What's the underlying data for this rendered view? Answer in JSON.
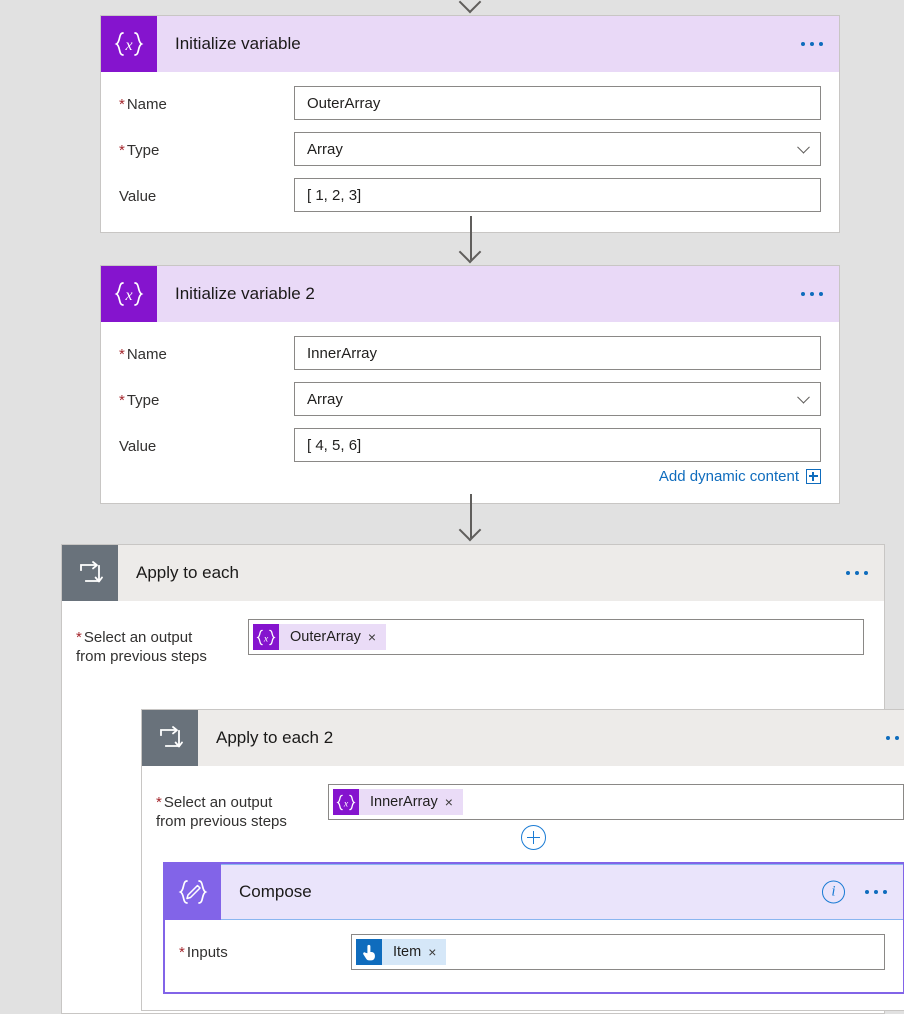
{
  "page": {
    "background_color": "#e1e1e1",
    "app": "Power Automate flow designer"
  },
  "colors": {
    "variable_icon": "#8514ce",
    "variable_header": "#e9d9f7",
    "loop_icon": "#69727b",
    "loop_header": "#edebe9",
    "compose_icon": "#8264e8",
    "compose_header": "#eae4fb",
    "selection_border": "#8264e8",
    "link_blue": "#0f6cbd",
    "required_red": "#a4262c",
    "item_token": "#0f6cbd"
  },
  "cards": {
    "initialize_variable_1": {
      "title": "Initialize variable",
      "icon": "variable-braces-x-icon",
      "menu": "more-commands",
      "fields": [
        {
          "label": "Name",
          "required": true,
          "value": "OuterArray",
          "control": "text"
        },
        {
          "label": "Type",
          "required": true,
          "value": "Array",
          "control": "dropdown"
        },
        {
          "label": "Value",
          "required": false,
          "value": "[ 1, 2, 3]",
          "control": "text"
        }
      ]
    },
    "initialize_variable_2": {
      "title": "Initialize variable 2",
      "icon": "variable-braces-x-icon",
      "menu": "more-commands",
      "fields": [
        {
          "label": "Name",
          "required": true,
          "value": "InnerArray",
          "control": "text"
        },
        {
          "label": "Type",
          "required": true,
          "value": "Array",
          "control": "dropdown"
        },
        {
          "label": "Value",
          "required": false,
          "value": "[ 4, 5, 6]",
          "control": "text"
        }
      ],
      "dynamic_content_link": "Add dynamic content"
    },
    "apply_to_each_1": {
      "title": "Apply to each",
      "icon": "loop-icon",
      "menu": "more-commands",
      "field": {
        "label_line1": "Select an output",
        "label_line2": "from previous steps",
        "required": true,
        "token": {
          "label": "OuterArray",
          "icon": "variable-braces-x-icon",
          "remove": "×"
        }
      }
    },
    "apply_to_each_2": {
      "title": "Apply to each 2",
      "icon": "loop-icon",
      "menu": "more-commands",
      "field": {
        "label_line1": "Select an output",
        "label_line2": "from previous steps",
        "required": true,
        "token": {
          "label": "InnerArray",
          "icon": "variable-braces-x-icon",
          "remove": "×"
        }
      },
      "add_step_button": "add-step-plus"
    },
    "compose": {
      "title": "Compose",
      "icon": "compose-pencil-braces-icon",
      "selected": true,
      "info": "info-icon",
      "menu": "more-commands",
      "fields": [
        {
          "label": "Inputs",
          "required": true,
          "token": {
            "label": "Item",
            "icon": "item-hand-pointer-icon",
            "remove": "×"
          }
        }
      ]
    }
  },
  "connectors": [
    {
      "name": "arrow-top-into-initialize-variable"
    },
    {
      "name": "arrow-initialize-variable-to-initialize-variable-2"
    },
    {
      "name": "arrow-initialize-variable-2-to-apply-to-each"
    }
  ]
}
